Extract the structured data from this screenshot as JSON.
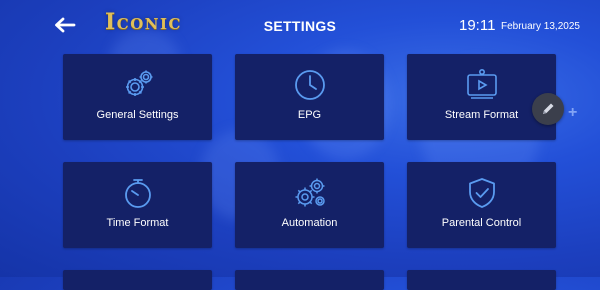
{
  "header": {
    "back_icon": "arrow-left-icon",
    "logo_text": "Iconic",
    "title": "SETTINGS",
    "time": "19:11",
    "date": "February 13,2025"
  },
  "tiles": [
    {
      "label": "General Settings",
      "icon": "gears-icon"
    },
    {
      "label": "EPG",
      "icon": "clock-icon"
    },
    {
      "label": "Stream Format",
      "icon": "video-player-icon"
    },
    {
      "label": "Time Format",
      "icon": "stopwatch-icon"
    },
    {
      "label": "Automation",
      "icon": "automation-gears-icon"
    },
    {
      "label": "Parental Control",
      "icon": "shield-check-icon"
    }
  ],
  "fab": {
    "icon": "pencil-icon"
  },
  "colors": {
    "background": "#2350d8",
    "tile": "#142167",
    "icon": "#5a9bf0",
    "logo": "#e0bf5a"
  }
}
